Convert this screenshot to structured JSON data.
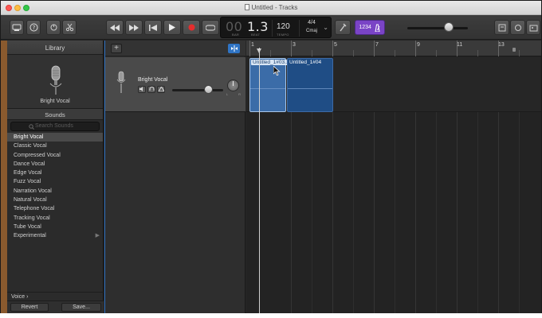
{
  "window": {
    "title": "Untitled - Tracks"
  },
  "toolbar": {
    "lcd": {
      "position_bar": "00",
      "position_beat": "1.3",
      "bar_label": "BAR",
      "beat_label": "BEAT",
      "tempo": "120",
      "tempo_label": "TEMPO",
      "time_signature": "4/4",
      "key": "Cmaj"
    },
    "count_in": "1234"
  },
  "library": {
    "title": "Library",
    "preview_name": "Bright Vocal",
    "sounds_label": "Sounds",
    "search_placeholder": "Search Sounds",
    "items": [
      "Bright Vocal",
      "Classic Vocal",
      "Compressed Vocal",
      "Dance Vocal",
      "Edge Vocal",
      "Fuzz Vocal",
      "Narration Vocal",
      "Natural Vocal",
      "Telephone Vocal",
      "Tracking Vocal",
      "Tube Vocal",
      "Experimental"
    ],
    "selected_index": 0,
    "category": "Voice",
    "revert_label": "Revert",
    "save_label": "Save..."
  },
  "track": {
    "name": "Bright Vocal",
    "pan_left": "L",
    "pan_right": "R"
  },
  "ruler": {
    "bars": [
      "1",
      "3",
      "5",
      "7",
      "9",
      "11",
      "13"
    ]
  },
  "regions": [
    {
      "label": "Untitled_1#03.1",
      "selected": true
    },
    {
      "label": "Untitled_1#04",
      "selected": false
    }
  ],
  "colors": {
    "region": "#1f4d85",
    "region_selected": "#3b6ca8",
    "count_in": "#7a44c6",
    "accent_blue": "#2f74c4"
  }
}
